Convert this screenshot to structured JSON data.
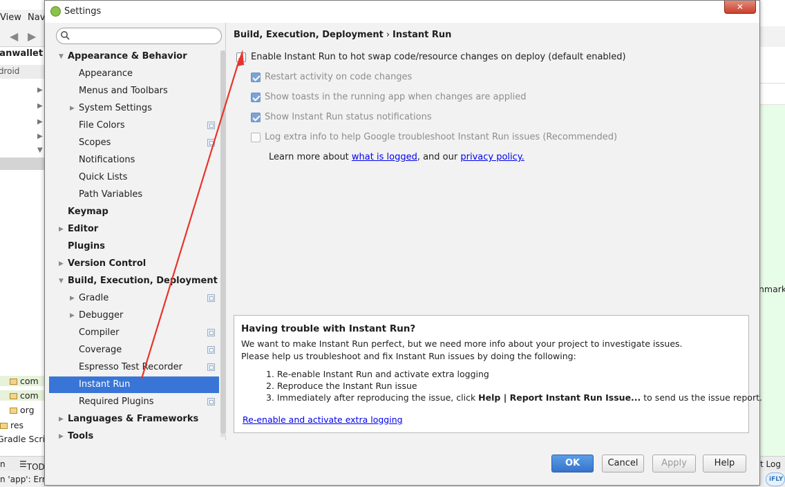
{
  "ide": {
    "menu": [
      "View",
      "Nav"
    ],
    "project_name": "banwallet",
    "project_view": "Android",
    "tree_rows": [
      "com",
      "com",
      "org",
      "res",
      "Gradle Scripts"
    ],
    "status_left": "n",
    "status_todo": "TODO",
    "status_error": "n 'app': Err",
    "right_text": "nmark",
    "right_status": "t Log",
    "badge": "iFLY"
  },
  "dialog": {
    "title": "Settings",
    "close_glyph": "✕"
  },
  "search": {
    "placeholder": "",
    "value": ""
  },
  "tree": [
    {
      "label": "Appearance & Behavior",
      "level": 0,
      "bold": true,
      "arrow": "expanded",
      "icon": false
    },
    {
      "label": "Appearance",
      "level": 1,
      "bold": false,
      "arrow": "none",
      "icon": false
    },
    {
      "label": "Menus and Toolbars",
      "level": 1,
      "bold": false,
      "arrow": "none",
      "icon": false
    },
    {
      "label": "System Settings",
      "level": 1,
      "bold": false,
      "arrow": "collapsed",
      "icon": false
    },
    {
      "label": "File Colors",
      "level": 1,
      "bold": false,
      "arrow": "none",
      "icon": true
    },
    {
      "label": "Scopes",
      "level": 1,
      "bold": false,
      "arrow": "none",
      "icon": true
    },
    {
      "label": "Notifications",
      "level": 1,
      "bold": false,
      "arrow": "none",
      "icon": false
    },
    {
      "label": "Quick Lists",
      "level": 1,
      "bold": false,
      "arrow": "none",
      "icon": false
    },
    {
      "label": "Path Variables",
      "level": 1,
      "bold": false,
      "arrow": "none",
      "icon": false
    },
    {
      "label": "Keymap",
      "level": 0,
      "bold": true,
      "arrow": "none",
      "icon": false
    },
    {
      "label": "Editor",
      "level": 0,
      "bold": true,
      "arrow": "collapsed",
      "icon": false
    },
    {
      "label": "Plugins",
      "level": 0,
      "bold": true,
      "arrow": "none",
      "icon": false
    },
    {
      "label": "Version Control",
      "level": 0,
      "bold": true,
      "arrow": "collapsed",
      "icon": false
    },
    {
      "label": "Build, Execution, Deployment",
      "level": 0,
      "bold": true,
      "arrow": "expanded",
      "icon": false
    },
    {
      "label": "Gradle",
      "level": 1,
      "bold": false,
      "arrow": "collapsed",
      "icon": true
    },
    {
      "label": "Debugger",
      "level": 1,
      "bold": false,
      "arrow": "collapsed",
      "icon": false
    },
    {
      "label": "Compiler",
      "level": 1,
      "bold": false,
      "arrow": "none",
      "icon": true
    },
    {
      "label": "Coverage",
      "level": 1,
      "bold": false,
      "arrow": "none",
      "icon": true
    },
    {
      "label": "Espresso Test Recorder",
      "level": 1,
      "bold": false,
      "arrow": "none",
      "icon": true
    },
    {
      "label": "Instant Run",
      "level": 1,
      "bold": false,
      "arrow": "none",
      "icon": false,
      "selected": true
    },
    {
      "label": "Required Plugins",
      "level": 1,
      "bold": false,
      "arrow": "none",
      "icon": true
    },
    {
      "label": "Languages & Frameworks",
      "level": 0,
      "bold": true,
      "arrow": "collapsed",
      "icon": false
    },
    {
      "label": "Tools",
      "level": 0,
      "bold": true,
      "arrow": "collapsed",
      "icon": false
    }
  ],
  "breadcrumb": {
    "parent": "Build, Execution, Deployment",
    "separator": "›",
    "current": "Instant Run"
  },
  "options": {
    "enable": {
      "label": "Enable Instant Run to hot swap code/resource changes on deploy (default enabled)",
      "checked": false
    },
    "restart": {
      "label": "Restart activity on code changes",
      "checked": true
    },
    "toasts": {
      "label": "Show toasts in the running app when changes are applied",
      "checked": true
    },
    "status": {
      "label": "Show Instant Run status notifications",
      "checked": true
    },
    "log_extra": {
      "label": "Log extra info to help Google troubleshoot Instant Run issues (Recommended)",
      "checked": false
    }
  },
  "learn_more": {
    "prefix": "Learn more about ",
    "link1": "what is logged",
    "middle": ", and our ",
    "link2": "privacy policy."
  },
  "trouble": {
    "title": "Having trouble with Instant Run?",
    "line1": "We want to make Instant Run perfect, but we need more info about your project to investigate issues.",
    "line2": "Please help us troubleshoot and fix Instant Run issues by doing the following:",
    "step1": "1. Re-enable Instant Run and activate extra logging",
    "step2": "2. Reproduce the Instant Run issue",
    "step3_prefix": "3. Immediately after reproducing the issue, click ",
    "step3_bold": "Help | Report Instant Run Issue...",
    "step3_suffix": " to send us the issue report.",
    "link": "Re-enable and activate extra logging"
  },
  "buttons": {
    "ok": "OK",
    "cancel": "Cancel",
    "apply": "Apply",
    "help": "Help"
  },
  "colors": {
    "selection": "#3875d7",
    "annotation": "#e8332a",
    "link": "#0000ee"
  }
}
